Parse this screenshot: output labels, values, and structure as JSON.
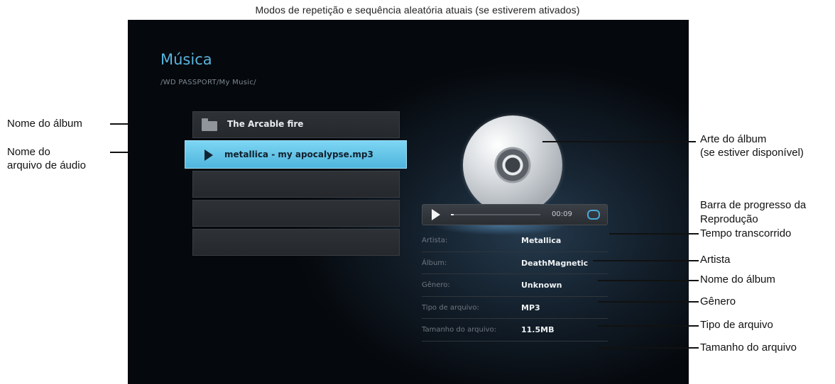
{
  "caption_top": "Modos de repetição e sequência aleatória atuais (se estiverem ativados)",
  "screen": {
    "title": "Música",
    "path": "/WD PASSPORT/My Music/",
    "list": [
      {
        "label": "The Arcable fire",
        "icon": "folder-icon"
      },
      {
        "label": "metallica - my apocalypse.mp3",
        "icon": "play-icon"
      },
      {
        "label": ""
      },
      {
        "label": ""
      },
      {
        "label": ""
      }
    ],
    "player": {
      "time": "00:09",
      "progress": 0.03
    },
    "info": {
      "artist_label": "Artista:",
      "artist": "Metallica",
      "album_label": "Álbum:",
      "album": "DeathMagnetic",
      "genre_label": "Gênero:",
      "genre": "Unknown",
      "filetype_label": "Tipo de arquivo:",
      "filetype": "MP3",
      "filesize_label": "Tamanho do arquivo:",
      "filesize": "11.5MB"
    },
    "accent_color": "#5ab3df"
  },
  "callouts": {
    "album_name_left": "Nome do álbum",
    "audio_file_line1": "Nome do",
    "audio_file_line2": "arquivo de áudio",
    "album_art_line1": "Arte do álbum",
    "album_art_line2": "(se estiver disponível)",
    "progress_line1": "Barra de progresso da",
    "progress_line2": "Reprodução",
    "elapsed": "Tempo transcorrido",
    "artist": "Artista",
    "album_name_right": "Nome do álbum",
    "genre": "Gênero",
    "filetype": "Tipo de arquivo",
    "filesize": "Tamanho do arquivo"
  }
}
